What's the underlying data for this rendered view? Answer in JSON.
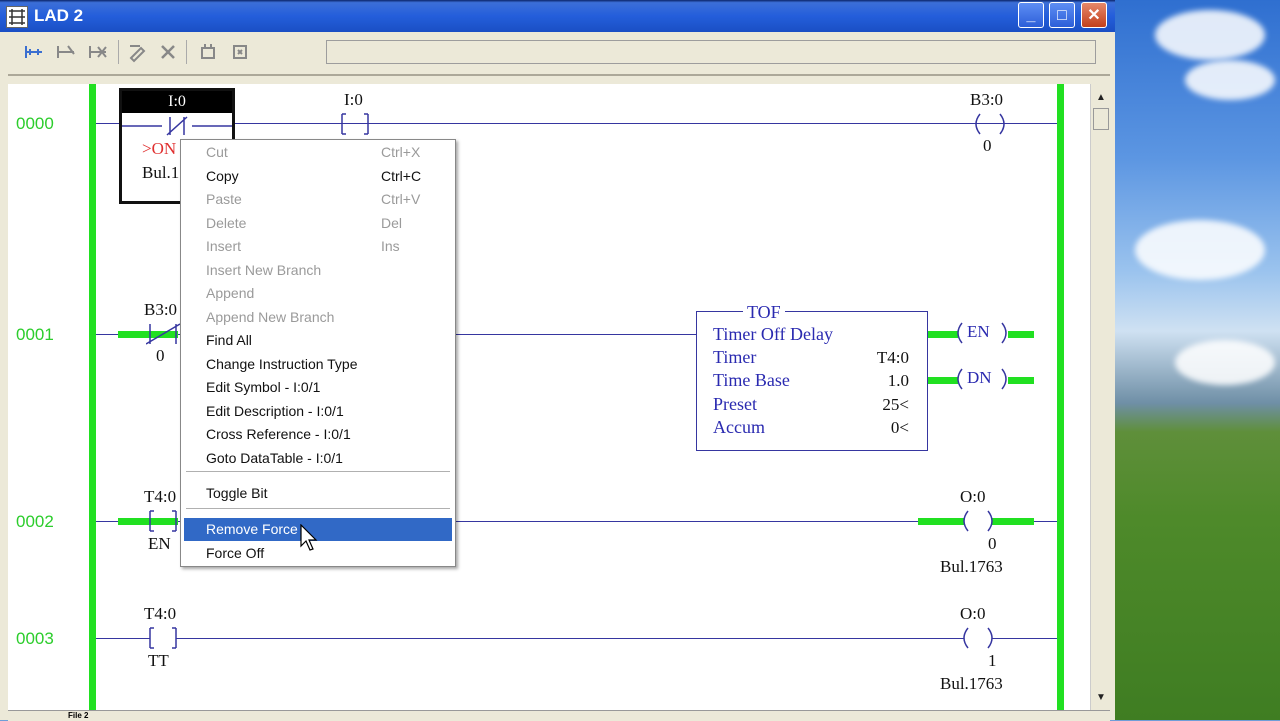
{
  "window": {
    "title": "LAD 2",
    "controls": {
      "minimize": "_",
      "maximize": "□",
      "close": "✕"
    }
  },
  "toolbar": {
    "icons": [
      "insert-rung-icon",
      "edit-rung-icon",
      "delete-rung-icon",
      "edit-icon",
      "cancel-icon",
      "accept-icon",
      "test-icon"
    ]
  },
  "rungs": [
    {
      "number": "0000",
      "instructions": [
        {
          "type": "xio",
          "address": "I:0",
          "sublabel": ">ON",
          "desc": "Bul.1"
        },
        {
          "type": "xic",
          "address": "I:0"
        },
        {
          "type": "ote",
          "address": "B3:0",
          "bit": "0"
        }
      ]
    },
    {
      "number": "0001",
      "instructions": [
        {
          "type": "xio",
          "address": "B3:0",
          "bit": "0"
        },
        {
          "type": "tof",
          "name": "TOF",
          "rows": [
            {
              "label": "Timer Off Delay",
              "value": ""
            },
            {
              "label": "Timer",
              "value": "T4:0"
            },
            {
              "label": "Time Base",
              "value": "1.0"
            },
            {
              "label": "Preset",
              "value": "25<"
            },
            {
              "label": "Accum",
              "value": "0<"
            }
          ],
          "outputs": [
            "EN",
            "DN"
          ]
        }
      ]
    },
    {
      "number": "0002",
      "instructions": [
        {
          "type": "xic",
          "address": "T4:0",
          "bit": "EN"
        },
        {
          "type": "ote",
          "address": "O:0",
          "bit": "0",
          "desc": "Bul.1763"
        }
      ]
    },
    {
      "number": "0003",
      "instructions": [
        {
          "type": "xic",
          "address": "T4:0",
          "bit": "TT"
        },
        {
          "type": "ote",
          "address": "O:0",
          "bit": "1",
          "desc": "Bul.1763"
        }
      ]
    }
  ],
  "context_menu": {
    "items": [
      {
        "label": "Cut",
        "shortcut": "Ctrl+X",
        "enabled": false
      },
      {
        "label": "Copy",
        "shortcut": "Ctrl+C",
        "enabled": true
      },
      {
        "label": "Paste",
        "shortcut": "Ctrl+V",
        "enabled": false
      },
      {
        "label": "Delete",
        "shortcut": "Del",
        "enabled": false
      },
      {
        "label": "Insert",
        "shortcut": "Ins",
        "enabled": false
      },
      {
        "label": "Insert New Branch",
        "shortcut": "",
        "enabled": false
      },
      {
        "label": "Append",
        "shortcut": "",
        "enabled": false
      },
      {
        "label": "Append New Branch",
        "shortcut": "",
        "enabled": false
      },
      {
        "label": "Find All",
        "shortcut": "",
        "enabled": true
      },
      {
        "label": "Change Instruction Type",
        "shortcut": "",
        "enabled": true
      },
      {
        "label": "Edit Symbol - I:0/1",
        "shortcut": "",
        "enabled": true
      },
      {
        "label": "Edit Description - I:0/1",
        "shortcut": "",
        "enabled": true
      },
      {
        "label": "Cross Reference - I:0/1",
        "shortcut": "",
        "enabled": true
      },
      {
        "label": "Goto DataTable - I:0/1",
        "shortcut": "",
        "enabled": true
      },
      {
        "label": "Toggle Bit",
        "shortcut": "",
        "enabled": true
      },
      {
        "label": "Remove Force",
        "shortcut": "",
        "enabled": true,
        "highlighted": true
      },
      {
        "label": "Force Off",
        "shortcut": "",
        "enabled": true
      }
    ]
  },
  "footer": {
    "tab": "File 2"
  },
  "colors": {
    "rail": "#21e021",
    "rung_number": "#2ccd2c",
    "wire": "#3636a0",
    "menu_highlight": "#3169c6",
    "titlebar": "#245edb"
  }
}
